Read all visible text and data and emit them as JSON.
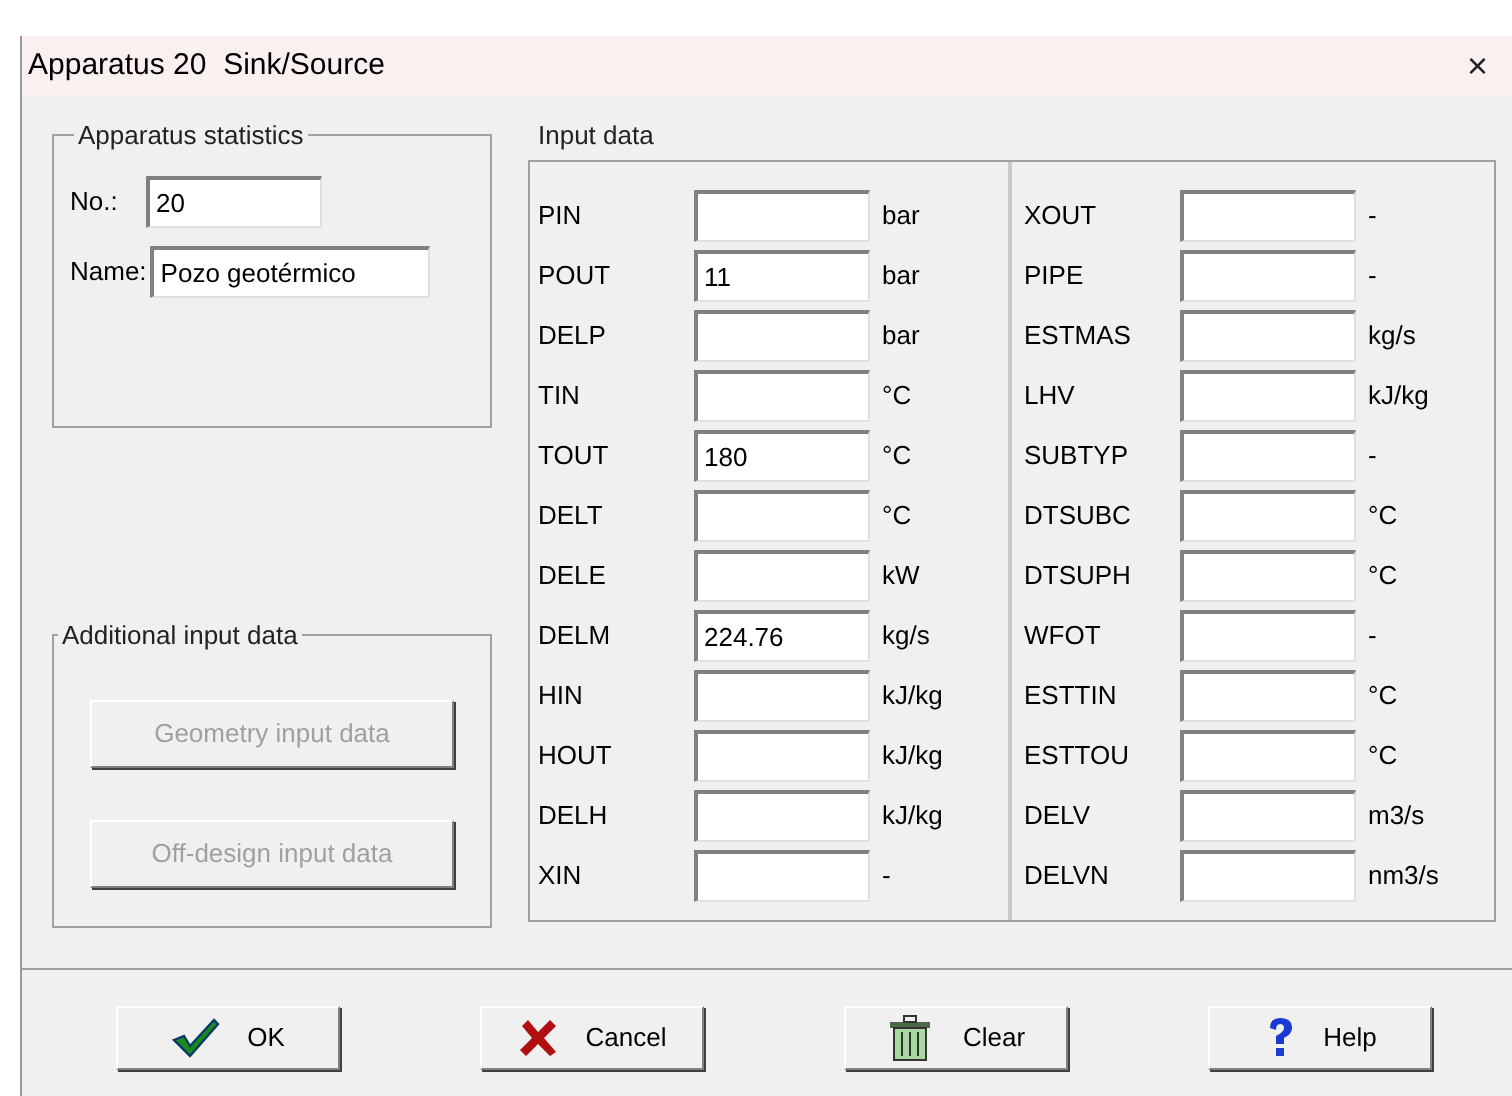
{
  "window": {
    "title": "Apparatus 20  Sink/Source",
    "close": "×"
  },
  "statistics": {
    "title": "Apparatus statistics",
    "fields": [
      {
        "label": "No.:",
        "value": "20"
      },
      {
        "label": "Name:",
        "value": "Pozo geotérmico"
      }
    ]
  },
  "additional": {
    "title": "Additional input data",
    "buttons": [
      {
        "label": "Geometry input data",
        "disabled": true
      },
      {
        "label": "Off-design input data",
        "disabled": true
      }
    ]
  },
  "input_data": {
    "title": "Input data",
    "columns": [
      [
        {
          "label": "PIN",
          "unit": "bar"
        },
        {
          "label": "POUT",
          "value": "11",
          "unit": "bar"
        },
        {
          "label": "DELP",
          "unit": "bar"
        },
        {
          "label": "TIN",
          "unit": "°C"
        },
        {
          "label": "TOUT",
          "value": "180",
          "unit": "°C"
        },
        {
          "label": "DELT",
          "unit": "°C"
        },
        {
          "label": "DELE",
          "unit": "kW"
        },
        {
          "label": "DELM",
          "value": "224.76",
          "unit": "kg/s"
        },
        {
          "label": "HIN",
          "unit": "kJ/kg"
        },
        {
          "label": "HOUT",
          "unit": "kJ/kg"
        },
        {
          "label": "DELH",
          "unit": "kJ/kg"
        },
        {
          "label": "XIN",
          "unit": "-"
        }
      ],
      [
        {
          "label": "XOUT",
          "unit": "-"
        },
        {
          "label": "PIPE",
          "unit": "-"
        },
        {
          "label": "ESTMAS",
          "unit": "kg/s"
        },
        {
          "label": "LHV",
          "unit": "kJ/kg"
        },
        {
          "label": "SUBTYP",
          "unit": "-"
        },
        {
          "label": "DTSUBC",
          "unit": "°C"
        },
        {
          "label": "DTSUPH",
          "unit": "°C"
        },
        {
          "label": "WFOT",
          "unit": "-"
        },
        {
          "label": "ESTTIN",
          "unit": "°C"
        },
        {
          "label": "ESTTOU",
          "unit": "°C"
        },
        {
          "label": "DELV",
          "unit": "m3/s"
        },
        {
          "label": "DELVN",
          "unit": "nm3/s"
        }
      ]
    ]
  },
  "buttons": [
    {
      "kind": "ok",
      "label": "OK"
    },
    {
      "kind": "cancel",
      "label": "Cancel"
    },
    {
      "kind": "clear",
      "label": "Clear"
    },
    {
      "kind": "help",
      "label": "Help"
    }
  ]
}
